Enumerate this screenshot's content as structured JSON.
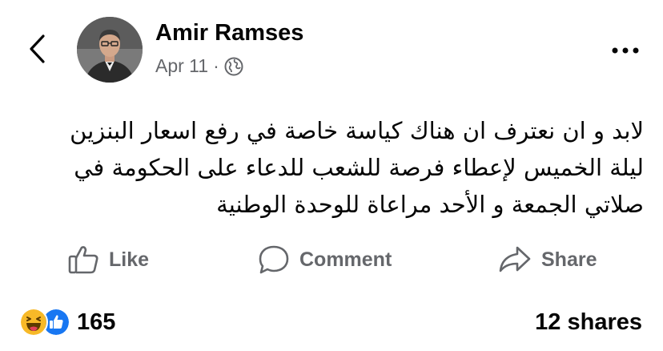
{
  "header": {
    "author_name": "Amir Ramses",
    "timestamp": "Apr 11",
    "separator": "·",
    "audience_icon": "globe-icon"
  },
  "post": {
    "lines": [
      "لابد و ان نعترف ان هناك كياسة خاصة في رفع اسعار البنزين",
      "ليلة الخميس لإعطاء فرصة للشعب للدعاء على الحكومة في",
      "صلاتي الجمعة و الأحد مراعاة للوحدة الوطنية"
    ]
  },
  "actions": {
    "like_label": "Like",
    "comment_label": "Comment",
    "share_label": "Share"
  },
  "footer": {
    "reactions": [
      "haha-icon",
      "like-icon"
    ],
    "reaction_count": "165",
    "shares_text": "12 shares"
  },
  "colors": {
    "text_primary": "#050505",
    "text_secondary": "#65676b",
    "like_blue": "#1877f2",
    "haha_yellow": "#f7b928"
  }
}
